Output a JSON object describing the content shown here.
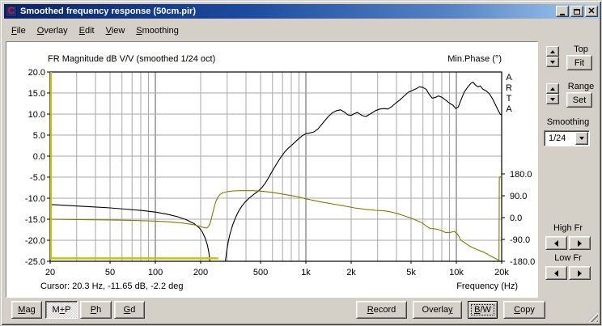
{
  "window": {
    "title": "Smoothed frequency response (50cm.pir)",
    "icon": "arta-app-icon",
    "icon_glyph": "C"
  },
  "menu": {
    "items": [
      {
        "label": "File",
        "accel": 0
      },
      {
        "label": "Overlay",
        "accel": 0
      },
      {
        "label": "Edit",
        "accel": 0
      },
      {
        "label": "View",
        "accel": 0
      },
      {
        "label": "Smoothing",
        "accel": 0
      }
    ]
  },
  "side_panel": {
    "top_label": "Top",
    "fit_label": "Fit",
    "range_label": "Range",
    "set_label": "Set",
    "smoothing_label": "Smoothing",
    "smoothing_value": "1/24",
    "high_fr_label": "High Fr",
    "low_fr_label": "Low Fr"
  },
  "bottom_bar": {
    "left": [
      {
        "label": "Mag",
        "accel": 0
      },
      {
        "label": "M+P",
        "accel": 1,
        "pressed": true
      },
      {
        "label": "Ph",
        "accel": 0
      },
      {
        "label": "Gd",
        "accel": 0
      }
    ],
    "right": [
      {
        "label": "Record",
        "accel": 0
      },
      {
        "label": "Overlay",
        "accel": 6
      },
      {
        "label": "B/W",
        "accel": 0,
        "focused": true
      },
      {
        "label": "Copy",
        "accel": 0
      }
    ]
  },
  "chart_data": {
    "type": "line",
    "title": "FR Magnitude dB V/V (smoothed 1/24 oct)",
    "right_axis_title": "Min.Phase (°)",
    "xlabel": "Frequency (Hz)",
    "cursor_text": "Cursor: 20.3 Hz, -11.65 dB, -2.2 deg",
    "watermark": "ARTA",
    "x_axis": {
      "scale": "log",
      "min": 20,
      "max": 20000,
      "ticks": [
        {
          "label": "20",
          "f": 20
        },
        {
          "label": "50",
          "f": 50
        },
        {
          "label": "100",
          "f": 100
        },
        {
          "label": "200",
          "f": 200
        },
        {
          "label": "500",
          "f": 500
        },
        {
          "label": "1k",
          "f": 1000
        },
        {
          "label": "2k",
          "f": 2000
        },
        {
          "label": "5k",
          "f": 5000
        },
        {
          "label": "10k",
          "f": 10000
        },
        {
          "label": "20k",
          "f": 20000
        }
      ],
      "minor_gridlines": [
        30,
        40,
        50,
        60,
        70,
        80,
        90,
        200,
        300,
        400,
        500,
        600,
        700,
        800,
        900,
        2000,
        3000,
        4000,
        5000,
        6000,
        7000,
        8000,
        9000
      ],
      "decade_gridlines": [
        100,
        1000,
        10000
      ]
    },
    "y_left": {
      "unit": "dB",
      "min": -25,
      "max": 20,
      "step": 5,
      "ticks": [
        {
          "label": "20.0",
          "db": 20
        },
        {
          "label": "15.0",
          "db": 15
        },
        {
          "label": "10.0",
          "db": 10
        },
        {
          "label": "5.0",
          "db": 5
        },
        {
          "label": "0.0",
          "db": 0
        },
        {
          "label": "-5.0",
          "db": -5
        },
        {
          "label": "-10.0",
          "db": -10
        },
        {
          "label": "-15.0",
          "db": -15
        },
        {
          "label": "-20.0",
          "db": -20
        },
        {
          "label": "-25.0",
          "db": -25
        }
      ]
    },
    "y_right": {
      "unit": "deg",
      "min": -180,
      "max": 180,
      "ticks": [
        {
          "label": "180.0",
          "deg": 180
        },
        {
          "label": "90.0",
          "deg": 90
        },
        {
          "label": "0.0",
          "deg": 0
        },
        {
          "label": "-90.0",
          "deg": -90
        },
        {
          "label": "-180.0",
          "deg": -180
        }
      ]
    },
    "series": [
      {
        "name": "magnitude",
        "color": "#000000",
        "width": 1.1,
        "axis": "db",
        "points": [
          [
            20,
            -11.5
          ],
          [
            25,
            -11.7
          ],
          [
            32,
            -11.9
          ],
          [
            40,
            -12.1
          ],
          [
            50,
            -12.3
          ],
          [
            63,
            -12.6
          ],
          [
            80,
            -12.9
          ],
          [
            100,
            -13.3
          ],
          [
            120,
            -13.8
          ],
          [
            140,
            -14.4
          ],
          [
            160,
            -15.1
          ],
          [
            180,
            -16
          ],
          [
            195,
            -17
          ],
          [
            205,
            -18
          ],
          [
            215,
            -19.6
          ],
          [
            222,
            -21.2
          ],
          [
            227,
            -23
          ],
          [
            231,
            -25.5
          ],
          [
            234,
            -29
          ],
          [
            286,
            -29
          ],
          [
            291,
            -25.5
          ],
          [
            298,
            -22.5
          ],
          [
            306,
            -20
          ],
          [
            315,
            -18.2
          ],
          [
            326,
            -16.4
          ],
          [
            340,
            -14.7
          ],
          [
            356,
            -13.2
          ],
          [
            375,
            -11.9
          ],
          [
            395,
            -10.9
          ],
          [
            420,
            -10
          ],
          [
            450,
            -9.1
          ],
          [
            480,
            -8.4
          ],
          [
            510,
            -7.5
          ],
          [
            540,
            -6.3
          ],
          [
            570,
            -4.9
          ],
          [
            600,
            -3.5
          ],
          [
            640,
            -1.8
          ],
          [
            680,
            -0.3
          ],
          [
            720,
            0.9
          ],
          [
            760,
            1.8
          ],
          [
            800,
            2.5
          ],
          [
            850,
            3.4
          ],
          [
            900,
            4.2
          ],
          [
            950,
            4.9
          ],
          [
            1000,
            5.3
          ],
          [
            1060,
            5.5
          ],
          [
            1120,
            5.7
          ],
          [
            1200,
            6.4
          ],
          [
            1300,
            7.9
          ],
          [
            1400,
            9.3
          ],
          [
            1500,
            10.3
          ],
          [
            1600,
            10.8
          ],
          [
            1700,
            11
          ],
          [
            1800,
            10.5
          ],
          [
            1900,
            9.8
          ],
          [
            2000,
            9.7
          ],
          [
            2100,
            10.1
          ],
          [
            2200,
            10.4
          ],
          [
            2350,
            9.7
          ],
          [
            2500,
            9.4
          ],
          [
            2700,
            10.1
          ],
          [
            2900,
            10.8
          ],
          [
            3100,
            11.2
          ],
          [
            3300,
            11.3
          ],
          [
            3500,
            11.2
          ],
          [
            3700,
            11.7
          ],
          [
            3900,
            12.4
          ],
          [
            4200,
            13.3
          ],
          [
            4500,
            14.3
          ],
          [
            4800,
            15.2
          ],
          [
            5100,
            15.6
          ],
          [
            5400,
            16
          ],
          [
            5700,
            16.5
          ],
          [
            6000,
            16.3
          ],
          [
            6300,
            15.9
          ],
          [
            6600,
            14.7
          ],
          [
            6900,
            13.8
          ],
          [
            7200,
            13.9
          ],
          [
            7600,
            14.3
          ],
          [
            8000,
            14
          ],
          [
            8500,
            13.3
          ],
          [
            9000,
            12.6
          ],
          [
            9500,
            12.1
          ],
          [
            9900,
            11.3
          ],
          [
            10300,
            11.7
          ],
          [
            10800,
            13.6
          ],
          [
            11300,
            15.3
          ],
          [
            11900,
            16.4
          ],
          [
            12500,
            17.3
          ],
          [
            12900,
            17.6
          ],
          [
            13400,
            16.9
          ],
          [
            13900,
            16.5
          ],
          [
            14400,
            16.7
          ],
          [
            15000,
            15.9
          ],
          [
            15800,
            15.5
          ],
          [
            16600,
            14.8
          ],
          [
            17400,
            13.6
          ],
          [
            18200,
            12.2
          ],
          [
            19000,
            10.8
          ],
          [
            19600,
            9.9
          ],
          [
            20000,
            9.8
          ]
        ]
      },
      {
        "name": "min_phase",
        "color": "#7d7d00",
        "width": 1.1,
        "axis": "deg",
        "points": [
          [
            20,
            -7
          ],
          [
            30,
            -8
          ],
          [
            45,
            -9.5
          ],
          [
            65,
            -11
          ],
          [
            90,
            -13.5
          ],
          [
            120,
            -17
          ],
          [
            150,
            -22
          ],
          [
            175,
            -28
          ],
          [
            195,
            -35
          ],
          [
            210,
            -41
          ],
          [
            220,
            -43
          ],
          [
            228,
            -32
          ],
          [
            235,
            -8
          ],
          [
            243,
            30
          ],
          [
            251,
            62
          ],
          [
            260,
            84
          ],
          [
            270,
            96
          ],
          [
            282,
            103
          ],
          [
            300,
            107
          ],
          [
            330,
            110
          ],
          [
            380,
            111
          ],
          [
            450,
            111
          ],
          [
            520,
            108
          ],
          [
            600,
            104
          ],
          [
            680,
            98
          ],
          [
            760,
            93
          ],
          [
            850,
            88
          ],
          [
            950,
            81
          ],
          [
            1100,
            72
          ],
          [
            1300,
            63
          ],
          [
            1550,
            55
          ],
          [
            1800,
            48
          ],
          [
            2100,
            40
          ],
          [
            2500,
            34
          ],
          [
            2900,
            30
          ],
          [
            3300,
            28
          ],
          [
            3700,
            23
          ],
          [
            4100,
            16
          ],
          [
            4500,
            7
          ],
          [
            4900,
            0
          ],
          [
            5400,
            -11
          ],
          [
            5900,
            -21
          ],
          [
            6300,
            -35
          ],
          [
            6700,
            -45
          ],
          [
            7300,
            -47
          ],
          [
            7900,
            -52
          ],
          [
            8500,
            -62
          ],
          [
            9100,
            -61
          ],
          [
            9700,
            -57
          ],
          [
            10200,
            -68
          ],
          [
            10700,
            -93
          ],
          [
            11400,
            -104
          ],
          [
            12200,
            -117
          ],
          [
            13000,
            -125
          ],
          [
            14000,
            -134
          ],
          [
            15000,
            -141
          ],
          [
            16000,
            -150
          ],
          [
            17000,
            -159
          ],
          [
            18000,
            -167
          ],
          [
            18800,
            -173
          ],
          [
            19200,
            -177
          ],
          [
            19300,
            167
          ],
          [
            20000,
            169
          ]
        ]
      },
      {
        "name": "phase_wrap_segment",
        "color": "#c6c600",
        "width": 2.5,
        "axis": "db",
        "points": [
          [
            20.2,
            20
          ],
          [
            20.2,
            -24.3
          ],
          [
            262,
            -24.3
          ]
        ]
      }
    ]
  }
}
